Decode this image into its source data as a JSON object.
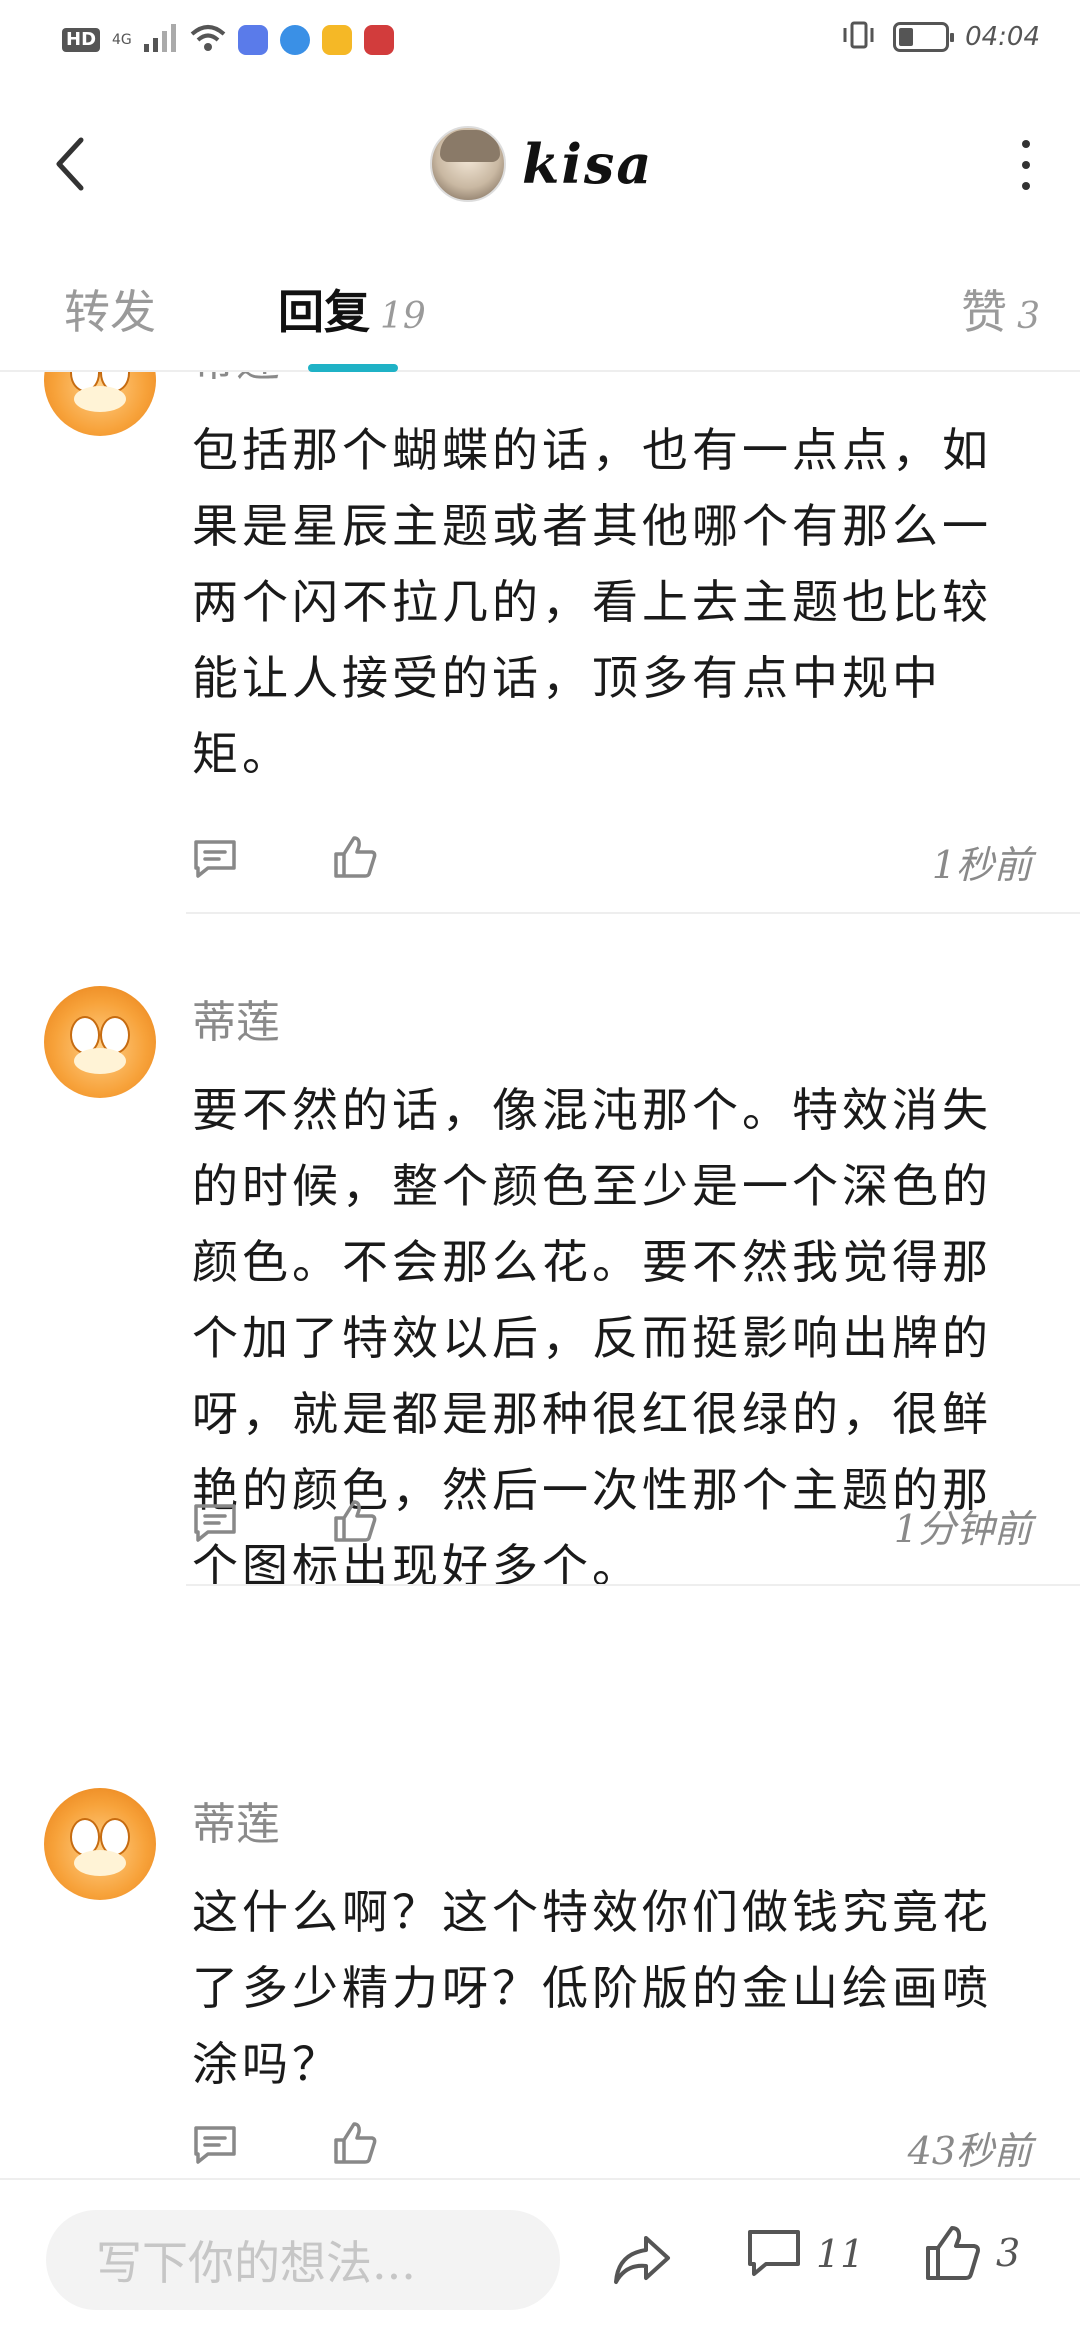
{
  "status_bar": {
    "network_badge": "HD",
    "network_type": "4G",
    "time": "04:04"
  },
  "header": {
    "title": "kisa"
  },
  "tabs": {
    "repost": {
      "label": "转发"
    },
    "reply": {
      "label": "回复",
      "count": "19"
    },
    "like": {
      "label": "赞",
      "count": "3"
    }
  },
  "comments": [
    {
      "name": "蒂莲",
      "text": "包括那个蝴蝶的话，也有一点点，如果是星辰主题或者其他哪个有那么一两个闪不拉几的，看上去主题也比较能让人接受的话，顶多有点中规中矩。",
      "time": "1秒前"
    },
    {
      "name": "蒂莲",
      "text": "要不然的话，像混沌那个。特效消失的时候，整个颜色至少是一个深色的颜色。不会那么花。要不然我觉得那个加了特效以后，反而挺影响出牌的呀，就是都是那种很红很绿的，很鲜艳的颜色，然后一次性那个主题的那个图标出现好多个。",
      "time": "1分钟前"
    },
    {
      "name": "蒂莲",
      "text": "这什么啊？这个特效你们做钱究竟花了多少精力呀？低阶版的金山绘画喷涂吗？",
      "time": "43秒前"
    }
  ],
  "bottom_bar": {
    "input_placeholder": "写下你的想法...",
    "comment_count": "11",
    "like_count": "3"
  },
  "colors": {
    "accent": "#1fb2c6",
    "muted_text": "#8a8a8a",
    "divider": "#eeeeee"
  }
}
